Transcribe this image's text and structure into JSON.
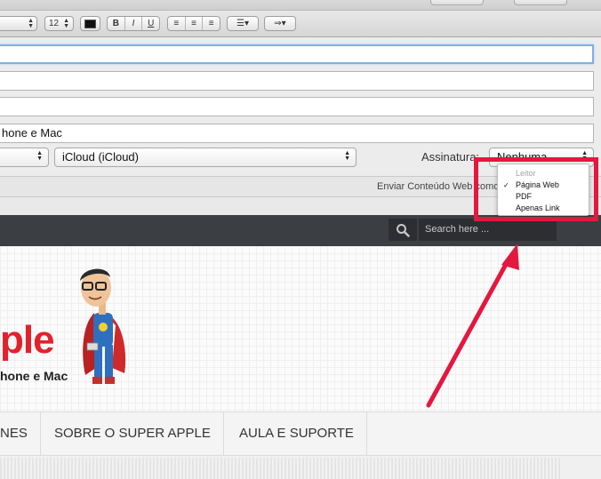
{
  "toolbar": {
    "font_size": "12",
    "bold": "B",
    "italic": "I",
    "underline": "U",
    "align_left": "≡",
    "align_center": "≡",
    "align_right": "≡",
    "list": "☰▾",
    "indent": "⇒▾"
  },
  "fields": {
    "subject_value": "hone e Mac",
    "account_popup": "iCloud (iCloud)",
    "signature_label": "Assinatura:",
    "signature_value": "Nenhuma"
  },
  "send_bar": {
    "label": "Enviar Conteúdo Web como:"
  },
  "menu": {
    "items": [
      {
        "label": "Leitor",
        "enabled": false,
        "checked": false
      },
      {
        "label": "Página Web",
        "enabled": true,
        "checked": true
      },
      {
        "label": "PDF",
        "enabled": true,
        "checked": false
      },
      {
        "label": "Apenas Link",
        "enabled": true,
        "checked": false
      }
    ],
    "check_mark": "✓"
  },
  "page": {
    "search_placeholder": "Search here ...",
    "logo_text": "ple",
    "logo_sub": "hone e Mac",
    "nav": [
      "NES",
      "SOBRE O SUPER APPLE",
      "AULA E SUPORTE"
    ]
  },
  "colors": {
    "highlight": "#e4173f",
    "topbar": "#3b3e43",
    "logo_red": "#e2222a"
  }
}
